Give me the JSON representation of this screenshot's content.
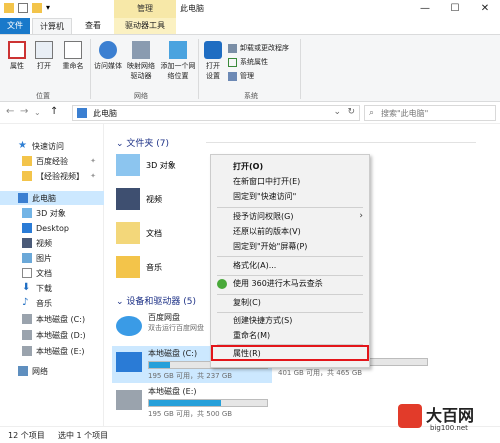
{
  "window": {
    "title": "此电脑",
    "context_tab_group": "管理",
    "controls": {
      "minimize": "—",
      "maximize": "☐",
      "close": "✕"
    }
  },
  "tabs": [
    "文件",
    "计算机",
    "查看",
    "驱动器工具"
  ],
  "ribbon": {
    "location_group": {
      "label": "位置",
      "buttons": [
        "属性",
        "打开",
        "重命名"
      ]
    },
    "network_group": {
      "label": "网络",
      "buttons": [
        "访问媒体",
        "映射网络驱动器",
        "添加一个网络位置"
      ]
    },
    "system_group": {
      "label": "系统",
      "buttons": [
        "打开设置"
      ],
      "small_buttons": [
        "卸载或更改程序",
        "系统属性",
        "管理"
      ]
    }
  },
  "address": {
    "crumb": "此电脑",
    "search_placeholder": "搜索\"此电脑\""
  },
  "nav": {
    "items": [
      {
        "label": "快速访问",
        "pinned": false
      },
      {
        "label": "百度经验",
        "pinned": true
      },
      {
        "label": "【经验视频】",
        "pinned": true
      },
      {
        "label": "此电脑",
        "pinned": false
      },
      {
        "label": "3D 对象",
        "pinned": false
      },
      {
        "label": "Desktop",
        "pinned": false
      },
      {
        "label": "视频",
        "pinned": false
      },
      {
        "label": "图片",
        "pinned": false
      },
      {
        "label": "文档",
        "pinned": false
      },
      {
        "label": "下载",
        "pinned": false
      },
      {
        "label": "音乐",
        "pinned": false
      },
      {
        "label": "本地磁盘 (C:)",
        "pinned": false
      },
      {
        "label": "本地磁盘 (D:)",
        "pinned": false
      },
      {
        "label": "本地磁盘 (E:)",
        "pinned": false
      },
      {
        "label": "网络",
        "pinned": false
      }
    ]
  },
  "content": {
    "folders_header": "文件夹 (7)",
    "folders": [
      "3D 对象",
      "视频",
      "文档",
      "音乐"
    ],
    "devices_header": "设备和驱动器 (5)",
    "devices": [
      {
        "name": "百度网盘",
        "sub": "双击运行百度网盘"
      },
      {
        "name": "本地磁盘 (C:)",
        "sub": "195 GB 可用，共 237 GB",
        "used_fraction": 0.18
      },
      {
        "name": "本地磁盘 (E:)",
        "sub": "195 GB 可用，共 500 GB",
        "used_fraction": 0.61
      },
      {
        "name": "",
        "sub": "401 GB 可用，共 465 GB",
        "used_fraction": 0.14
      }
    ]
  },
  "context_menu": {
    "items": [
      "打开(O)",
      "在新窗口中打开(E)",
      "固定到\"快速访问\"",
      "授予访问权限(G)",
      "还原以前的版本(V)",
      "固定到\"开始\"屏幕(P)",
      "格式化(A)...",
      "使用 360进行木马云查杀",
      "复制(C)",
      "创建快捷方式(S)",
      "重命名(M)",
      "属性(R)"
    ]
  },
  "status": {
    "count": "12 个项目",
    "selected": "选中 1 个项目"
  },
  "watermark": {
    "title": "大百网",
    "url": "big100.net"
  },
  "colors": {
    "accent": "#1979ca",
    "selection": "#cce8ff",
    "highlight_box": "#e3151a",
    "drive_bar": "#26a0da"
  }
}
